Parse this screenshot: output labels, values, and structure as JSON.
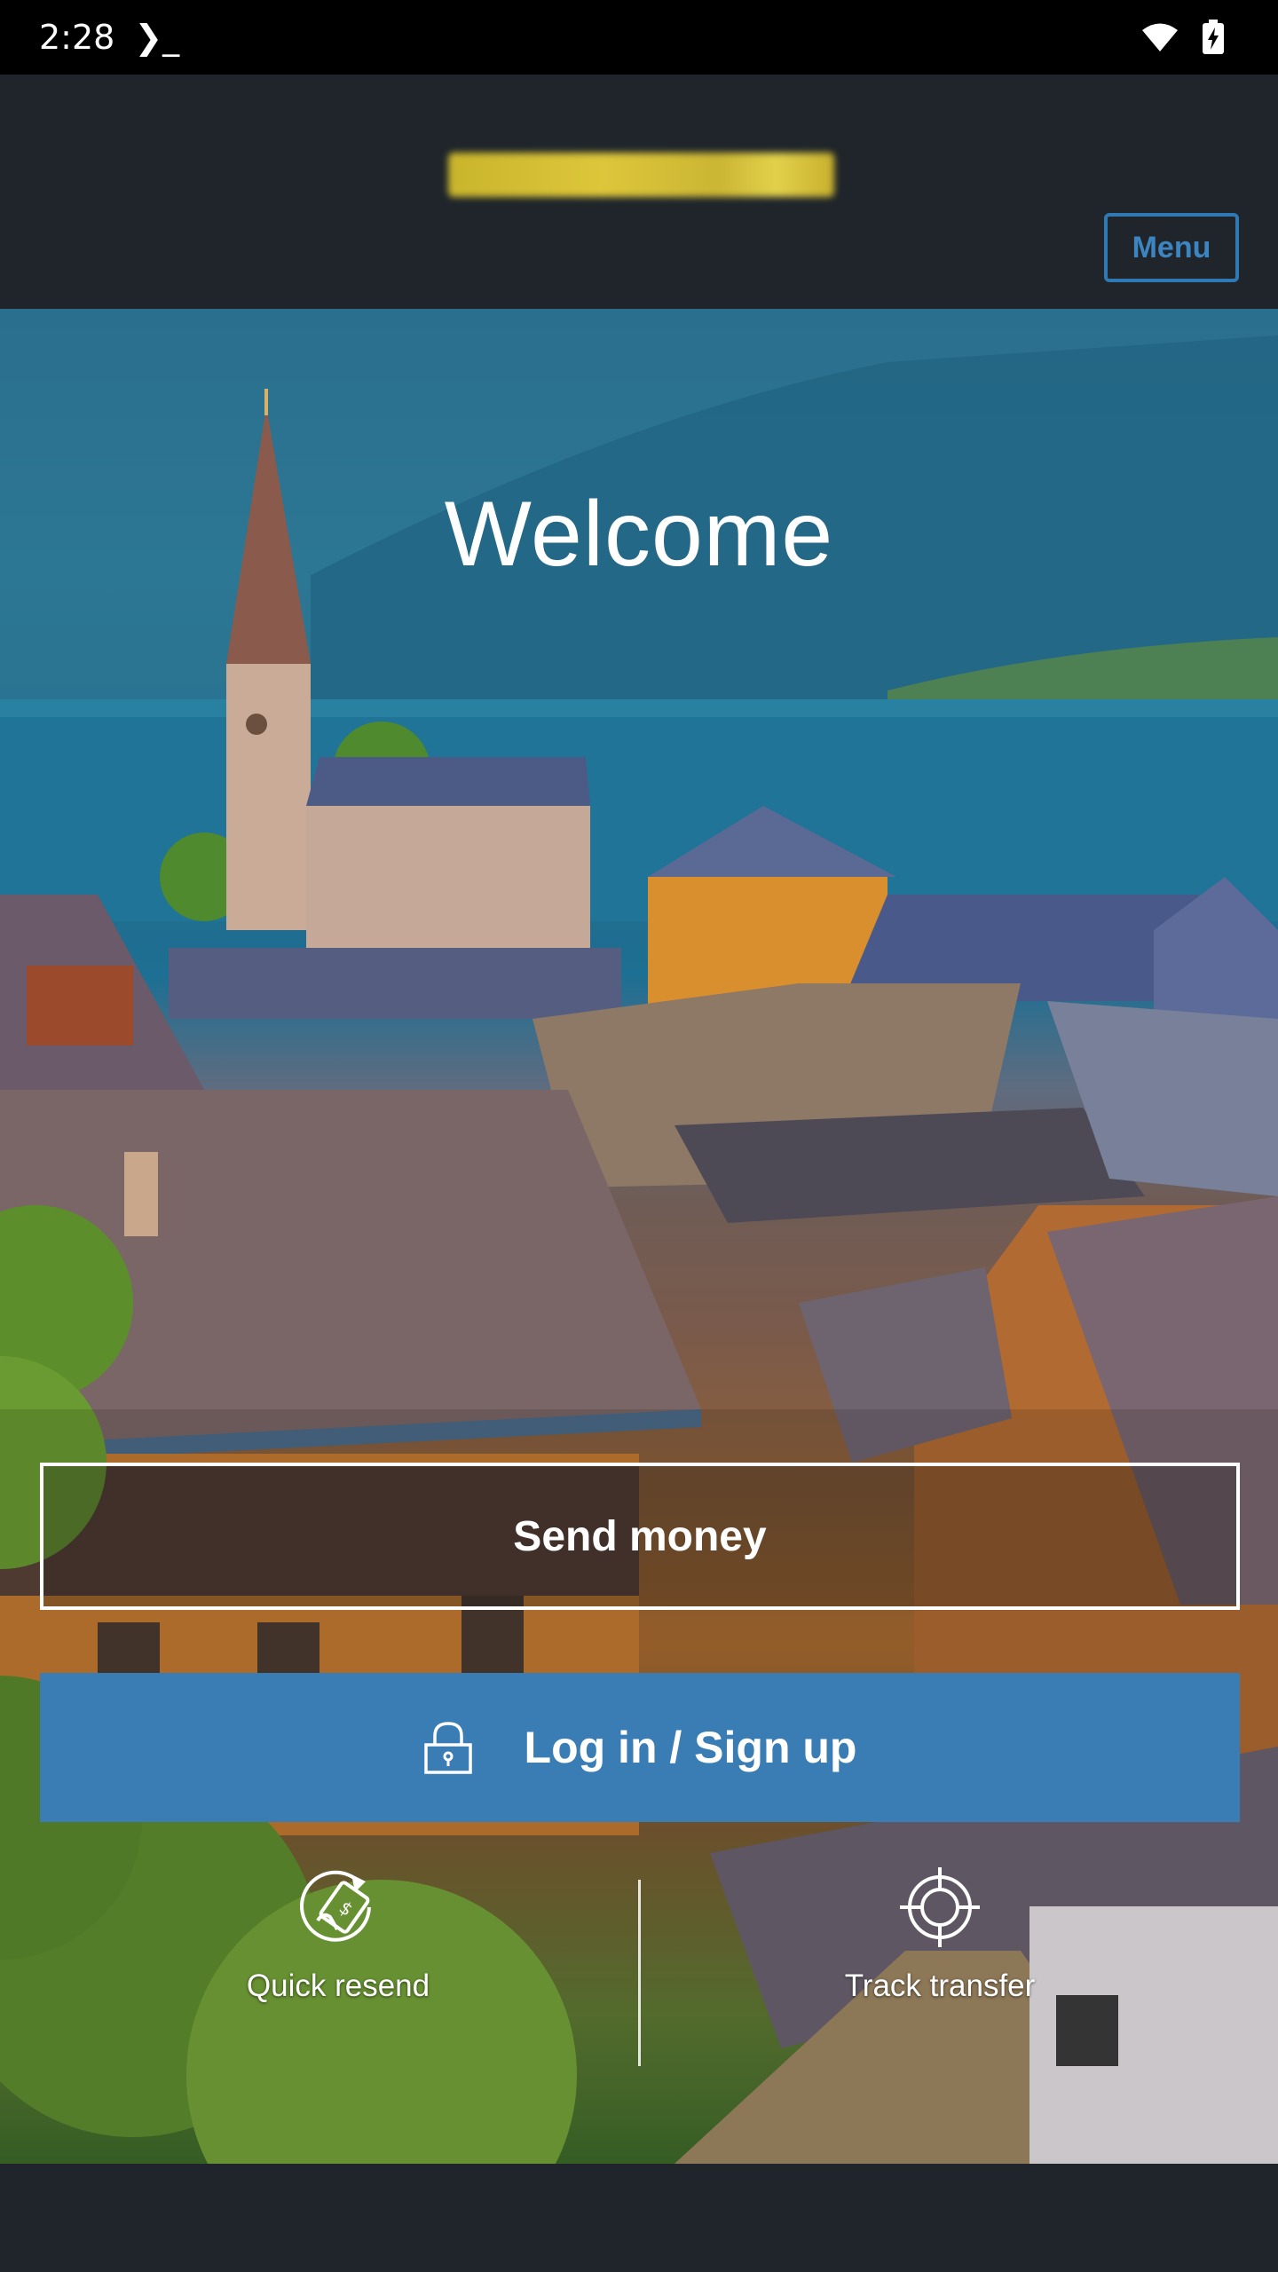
{
  "status_bar": {
    "time": "2:28",
    "terminal_glyph": "❯_"
  },
  "header": {
    "menu_label": "Menu"
  },
  "hero": {
    "title": "Welcome"
  },
  "actions": {
    "send_money_label": "Send money",
    "login_label": "Log in / Sign up"
  },
  "quick_links": [
    {
      "label": "Quick resend",
      "icon": "money-resend-icon"
    },
    {
      "label": "Track transfer",
      "icon": "crosshair-icon"
    }
  ],
  "colors": {
    "header_bg": "#1f252b",
    "accent": "#3a7db4",
    "menu_border": "#2f79b4"
  }
}
